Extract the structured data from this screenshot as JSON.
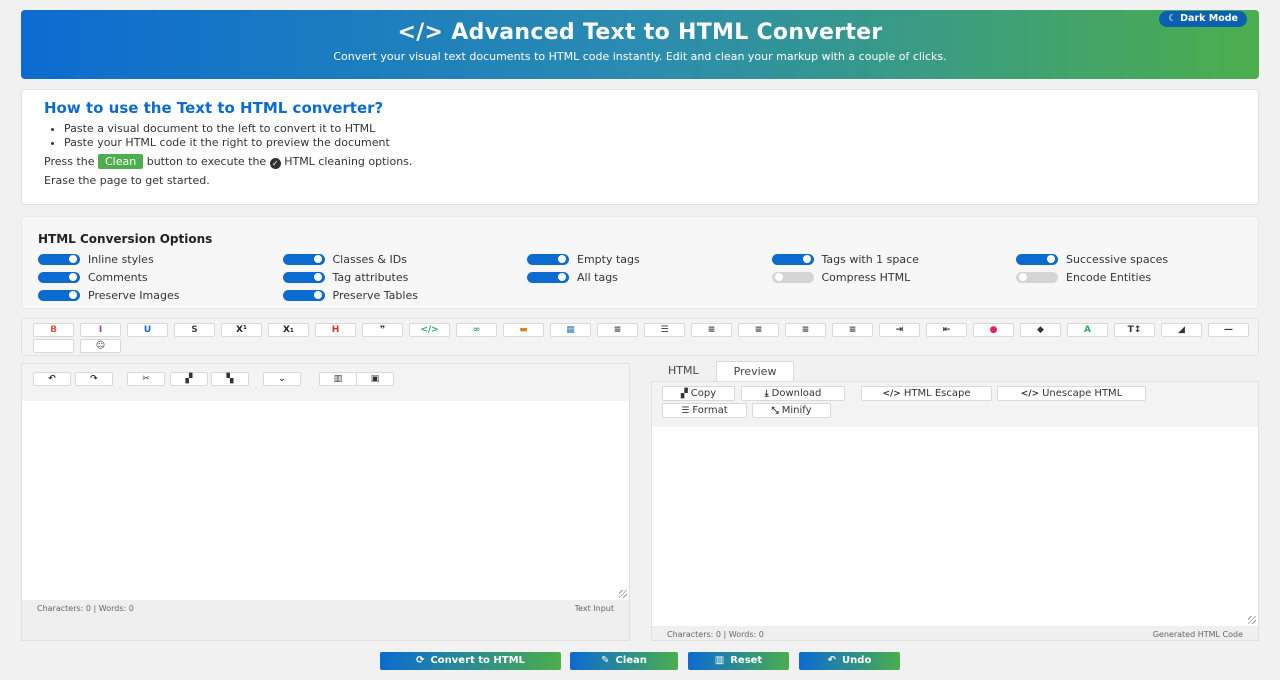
{
  "header": {
    "title": "</> Advanced Text to HTML Converter",
    "subtitle": "Convert your visual text documents to HTML code instantly. Edit and clean your markup with a couple of clicks.",
    "dark_mode_label": "Dark Mode",
    "dark_mode_icon": "moon-icon"
  },
  "howto": {
    "title": "How to use the Text to HTML converter?",
    "bullets": [
      "Paste a visual document to the left to convert it to HTML",
      "Paste your HTML code it the right to preview the document"
    ],
    "press_pre": "Press the",
    "clean_pill": "Clean",
    "press_mid": "button to execute the",
    "press_post": "HTML cleaning options.",
    "erase": "Erase the page to get started."
  },
  "options": {
    "title": "HTML Conversion Options",
    "items": [
      {
        "label": "Inline styles",
        "on": true
      },
      {
        "label": "Classes & IDs",
        "on": true
      },
      {
        "label": "Empty tags",
        "on": true
      },
      {
        "label": "Tags with 1 space",
        "on": true
      },
      {
        "label": "Successive spaces",
        "on": true
      },
      {
        "label": "Comments",
        "on": true
      },
      {
        "label": "Tag attributes",
        "on": true
      },
      {
        "label": "All tags",
        "on": true
      },
      {
        "label": "Compress HTML",
        "on": false
      },
      {
        "label": "Encode Entities",
        "on": false
      },
      {
        "label": "Preserve Images",
        "on": true
      },
      {
        "label": "Preserve Tables",
        "on": true
      }
    ]
  },
  "format_toolbar": [
    {
      "icon": "bold-icon",
      "glyph": "B",
      "color": "#d9534f"
    },
    {
      "icon": "italic-icon",
      "glyph": "I",
      "color": "#8e44ad"
    },
    {
      "icon": "underline-icon",
      "glyph": "U",
      "color": "#0c6bd1"
    },
    {
      "icon": "strikethrough-icon",
      "glyph": "S",
      "color": "#444444"
    },
    {
      "icon": "superscript-icon",
      "glyph": "X¹",
      "color": "#222222"
    },
    {
      "icon": "subscript-icon",
      "glyph": "X₁",
      "color": "#222222"
    },
    {
      "icon": "heading-icon",
      "glyph": "H",
      "color": "#c0392b"
    },
    {
      "icon": "quote-icon",
      "glyph": "❞",
      "color": "#333333"
    },
    {
      "icon": "code-icon",
      "glyph": "</>",
      "color": "#27ae60"
    },
    {
      "icon": "link-icon",
      "glyph": "∞",
      "color": "#27ae60"
    },
    {
      "icon": "image-icon",
      "glyph": "▬",
      "color": "#e67e22"
    },
    {
      "icon": "table-icon",
      "glyph": "▦",
      "color": "#2980b9"
    },
    {
      "icon": "ordered-list-icon",
      "glyph": "≡",
      "color": "#333333"
    },
    {
      "icon": "unordered-list-icon",
      "glyph": "☰",
      "color": "#333333"
    },
    {
      "icon": "align-left-icon",
      "glyph": "≡",
      "color": "#333333"
    },
    {
      "icon": "align-center-icon",
      "glyph": "≡",
      "color": "#333333"
    },
    {
      "icon": "align-right-icon",
      "glyph": "≡",
      "color": "#333333"
    },
    {
      "icon": "align-justify-icon",
      "glyph": "≡",
      "color": "#333333"
    },
    {
      "icon": "indent-icon",
      "glyph": "⇥",
      "color": "#333333"
    },
    {
      "icon": "outdent-icon",
      "glyph": "⇤",
      "color": "#333333"
    },
    {
      "icon": "palette-icon",
      "glyph": "●",
      "color": "#e91e63"
    },
    {
      "icon": "fill-color-icon",
      "glyph": "◆",
      "color": "#333333"
    },
    {
      "icon": "font-color-icon",
      "glyph": "A",
      "color": "#27ae60"
    },
    {
      "icon": "font-size-icon",
      "glyph": "T↕",
      "color": "#333333"
    },
    {
      "icon": "eraser-icon",
      "glyph": "◢",
      "color": "#333333"
    },
    {
      "icon": "horizontal-rule-icon",
      "glyph": "—",
      "color": "#333333"
    },
    {
      "icon": "blank-icon",
      "glyph": "",
      "color": "#333333"
    },
    {
      "icon": "emoji-icon",
      "glyph": "☺",
      "color": "#333333"
    }
  ],
  "left_editor": {
    "tools": [
      {
        "icon": "undo-icon",
        "glyph": "↶"
      },
      {
        "icon": "redo-icon",
        "glyph": "↷"
      },
      {
        "icon": "cut-icon",
        "glyph": "✂"
      },
      {
        "icon": "copy-icon",
        "glyph": "▞"
      },
      {
        "icon": "paste-icon",
        "glyph": "▚"
      },
      {
        "icon": "select-all-icon",
        "glyph": "⌄"
      },
      {
        "icon": "delete-icon",
        "glyph": "▥"
      },
      {
        "icon": "save-icon",
        "glyph": "▣"
      }
    ],
    "stats": "Characters: 0 | Words: 0",
    "label": "Text Input"
  },
  "right_panel": {
    "tabs": [
      "HTML",
      "Preview"
    ],
    "buttons": {
      "copy": "Copy",
      "download": "Download",
      "escape": "HTML Escape",
      "unescape": "Unescape HTML",
      "format": "Format",
      "minify": "Minify"
    },
    "stats": "Characters: 0 | Words: 0",
    "label": "Generated HTML Code"
  },
  "actions": {
    "convert": "Convert to HTML",
    "clean": "Clean",
    "reset": "Reset",
    "undo": "Undo"
  },
  "colors": {
    "primary": "#0c6bd1",
    "accent": "#4cae4c"
  }
}
